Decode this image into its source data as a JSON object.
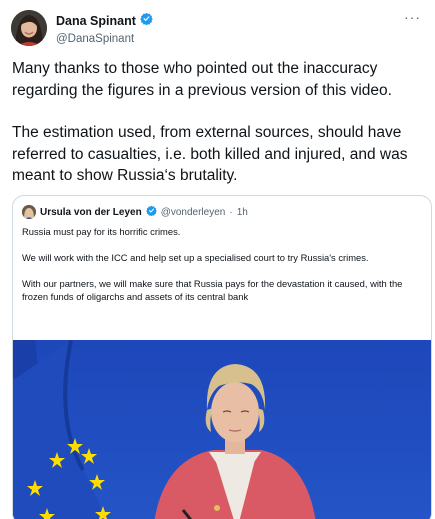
{
  "author": {
    "display_name": "Dana Spinant",
    "handle": "@DanaSpinant",
    "verified": true,
    "more_label": "···"
  },
  "tweet": {
    "paragraphs": [
      "Many thanks to those who pointed out the inaccuracy regarding the figures in a previous version of this video.",
      "The estimation used, from external sources, should have referred to casualties, i.e. both killed and injured, and was meant to show Russia‘s brutality."
    ]
  },
  "quoted_tweet": {
    "display_name": "Ursula von der Leyen",
    "handle": "@vonderleyen",
    "separator": "·",
    "time": "1h",
    "verified": true,
    "paragraphs": [
      "Russia must pay for its horrific crimes.",
      "We will work with the ICC and help set up a specialised court to try Russia's crimes.",
      "With our partners, we will make sure that Russia pays for the devastation it caused, with the frozen funds of oligarchs and assets of its central bank"
    ]
  },
  "colors": {
    "verified": "#1d9bf0",
    "text": "#0f1419",
    "secondary": "#536471",
    "border": "#cfd9de",
    "eu_blue": "#1f4bbd",
    "eu_star": "#ffdd00"
  }
}
